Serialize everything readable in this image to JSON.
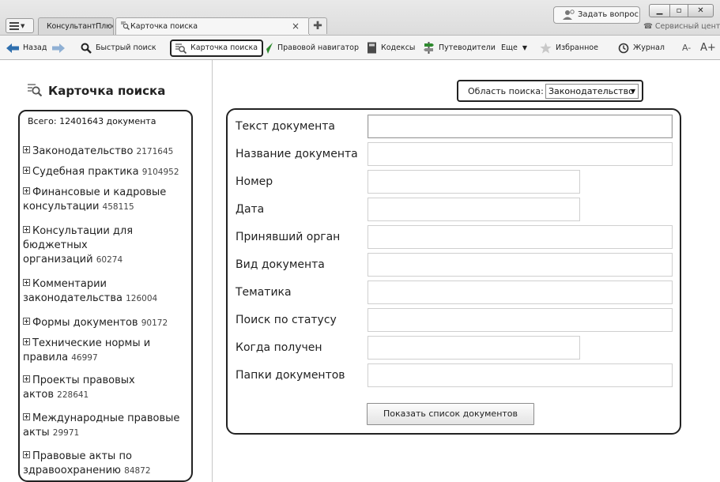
{
  "titlebar": {
    "tabs": [
      {
        "label": "КонсультантПлюс"
      },
      {
        "label": "Карточка поиска",
        "close": "×"
      }
    ],
    "new_tab": "✚",
    "ask_button": "Задать вопрос",
    "service_center": "Сервисный центр"
  },
  "toolbar": {
    "back": "Назад",
    "quick_search": "Быстрый поиск",
    "search_card": "Карточка поиска",
    "legal_navigator": "Правовой навигатор",
    "codes": "Кодексы",
    "guides": "Путеводители",
    "more": "Еще",
    "favorites": "Избранное",
    "journal": "Журнал",
    "font_smaller": "A-",
    "font_larger": "A+"
  },
  "sidebar": {
    "title": "Карточка поиска",
    "total": "Всего: 12401643 документа",
    "categories": [
      {
        "name": "Законодательство",
        "count": "2171645"
      },
      {
        "name": "Судебная практика",
        "count": "9104952"
      },
      {
        "name_lines": [
          "Финансовые и кадровые",
          "консультации"
        ],
        "count": "458115"
      },
      {
        "name_lines": [
          "Консультации для",
          "бюджетных",
          "организаций"
        ],
        "count": "60274"
      },
      {
        "name_lines": [
          "Комментарии",
          "законодательства"
        ],
        "count": "126004"
      },
      {
        "name": "Формы документов",
        "count": "90172"
      },
      {
        "name_lines": [
          "Технические нормы и",
          "правила"
        ],
        "count": "46997"
      },
      {
        "name_lines": [
          "Проекты правовых",
          "актов"
        ],
        "count": "228641"
      },
      {
        "name_lines": [
          "Международные правовые",
          "акты"
        ],
        "count": "29971"
      },
      {
        "name_lines": [
          "Правовые акты по",
          "здравоохранению"
        ],
        "count": "84872"
      }
    ]
  },
  "search_area": {
    "label": "Область поиска:",
    "selected": "Законодательство"
  },
  "form": {
    "fields": [
      {
        "label": "Текст документа"
      },
      {
        "label": "Название документа"
      },
      {
        "label": "Номер"
      },
      {
        "label": "Дата"
      },
      {
        "label": "Принявший орган"
      },
      {
        "label": "Вид документа"
      },
      {
        "label": "Тематика"
      },
      {
        "label": "Поиск по статусу"
      },
      {
        "label": "Когда получен"
      },
      {
        "label": "Папки документов"
      }
    ],
    "show_button": "Показать список документов"
  },
  "colors": {
    "accent_green": "#2f8a2f",
    "frame_dark": "#222222",
    "toolbar_bg": "#f4f4f4"
  }
}
